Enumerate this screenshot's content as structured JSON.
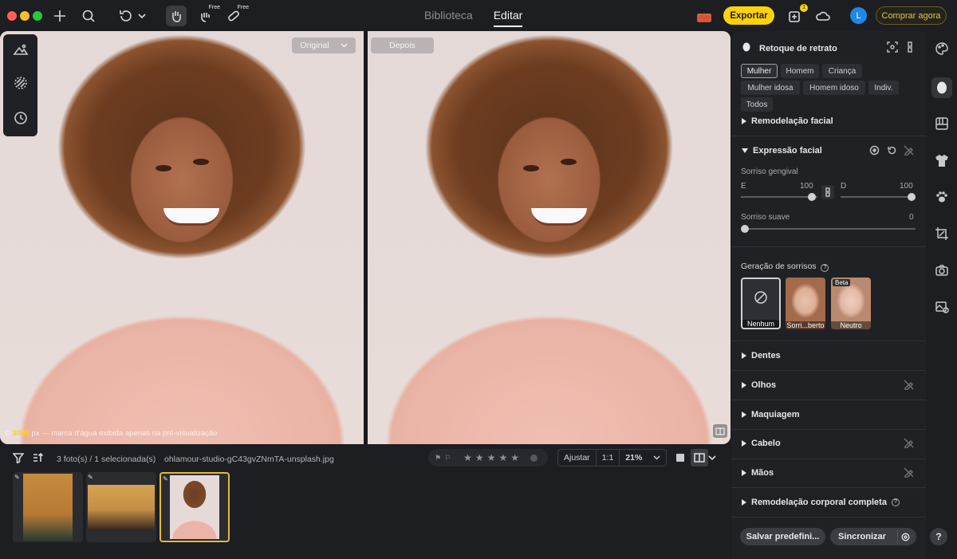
{
  "topbar": {
    "tabs": [
      "Biblioteca",
      "Editar"
    ],
    "active_tab": "Editar",
    "free_label": "Free",
    "export_label": "Exportar",
    "notification_count": "1",
    "avatar_initial": "L",
    "buy_label": "Comprar agora"
  },
  "canvas": {
    "before_label": "Original",
    "after_label": "Depois",
    "watermark_count": "3000",
    "watermark_text": "px — marca d'água exibida apenas na pré-visualização"
  },
  "filmstrip": {
    "count_text": "3 foto(s) / 1 selecionada(s)",
    "filename": "ohlamour-studio-gC43gvZNmTA-unsplash.jpg",
    "adjust_label": "Ajustar",
    "ratio_label": "1:1",
    "zoom_value": "21%",
    "thumbnails": [
      "thumb-1",
      "thumb-2",
      "thumb-3"
    ],
    "selected_index": 2
  },
  "panel": {
    "title": "Retoque de retrato",
    "subjects": [
      "Mulher",
      "Homem",
      "Criança",
      "Mulher idosa",
      "Homem idoso",
      "Indiv.",
      "Todos"
    ],
    "active_subject": "Mulher",
    "sections": {
      "face_reshape": "Remodelação facial",
      "expression": "Expressão facial",
      "teeth": "Dentes",
      "eyes": "Olhos",
      "makeup": "Maquiagem",
      "hair": "Cabelo",
      "hands": "Mãos",
      "body": "Remodelação corporal completa"
    },
    "gummy_smile": {
      "label": "Sorriso gengival",
      "left_label": "E",
      "left_value": "100",
      "right_label": "D",
      "right_value": "100"
    },
    "soft_smile": {
      "label": "Sorriso suave",
      "value": "0"
    },
    "smile_gen": {
      "label": "Geração de sorrisos",
      "options": [
        "Nenhum",
        "Sorri...berto",
        "Neutro"
      ],
      "beta_label": "Beta"
    },
    "save_preset_label": "Salvar predefini...",
    "sync_label": "Sincronizar"
  },
  "help_label": "?",
  "colors": {
    "accent": "#ffd20a",
    "avatar": "#1e88e5",
    "panel_bg": "#1f2124"
  }
}
